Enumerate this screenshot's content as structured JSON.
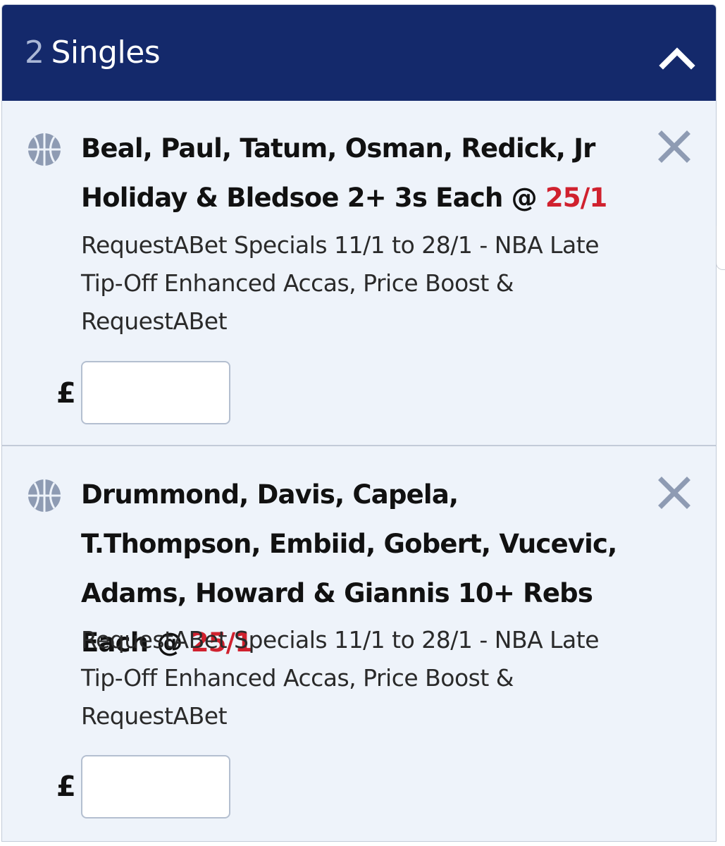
{
  "header": {
    "count": "2",
    "title": "Singles"
  },
  "bets": [
    {
      "selection": "Beal, Paul, Tatum, Osman, Redick, Jr Holiday & Bledsoe 2+ 3s Each @ ",
      "odds": "25/1",
      "market": "RequestABet Specials 11/1 to 28/1 - NBA Late Tip-Off Enhanced Accas, Price Boost & RequestABet",
      "currency": "£",
      "stake": ""
    },
    {
      "selection": "Drummond, Davis, Capela, T.Thompson, Embiid, Gobert, Vucevic, Adams, Howard & Giannis 10+ Rebs Each @ ",
      "odds": "25/1",
      "market": "RequestABet Specials 11/1 to 28/1 - NBA Late Tip-Off Enhanced Accas, Price Boost & RequestABet",
      "currency": "£",
      "stake": ""
    }
  ],
  "icons": {
    "sport": "basketball-icon",
    "remove": "close-icon",
    "collapse": "chevron-up-icon"
  },
  "colors": {
    "header_bg": "#14296b",
    "odds": "#d0212e",
    "card_bg": "#eef3fa",
    "icon_grey": "#8e9bb3"
  }
}
